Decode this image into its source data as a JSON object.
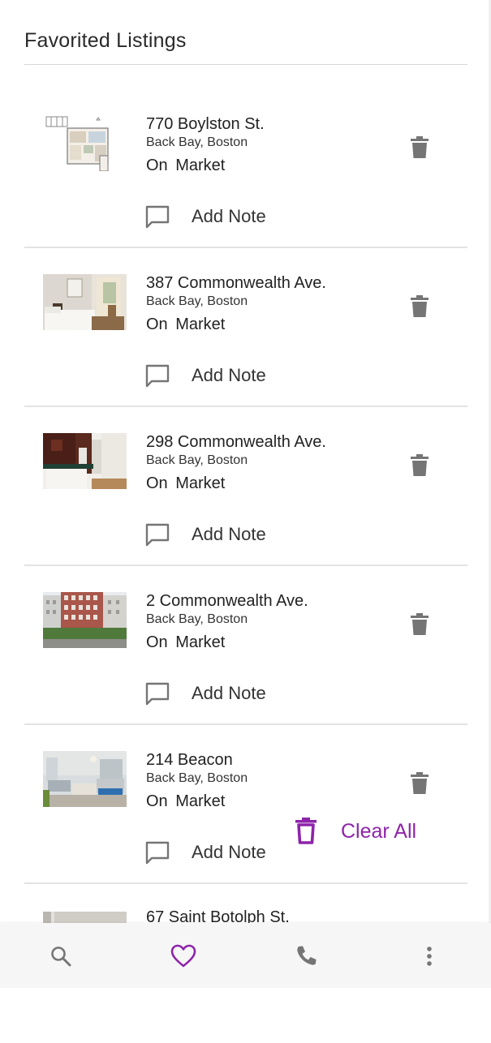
{
  "header": {
    "title": "Favorited Listings"
  },
  "listings": [
    {
      "address": "770 Boylston St.",
      "neighborhood": "Back Bay, Boston",
      "status": "On Market",
      "note_label": "Add Note",
      "photo": "floorplan"
    },
    {
      "address": "387 Commonwealth Ave.",
      "neighborhood": "Back Bay, Boston",
      "status": "On Market",
      "note_label": "Add Note",
      "photo": "bedroom"
    },
    {
      "address": "298 Commonwealth Ave.",
      "neighborhood": "Back Bay, Boston",
      "status": "On Market",
      "note_label": "Add Note",
      "photo": "kitchen"
    },
    {
      "address": "2 Commonwealth Ave.",
      "neighborhood": "Back Bay, Boston",
      "status": "On Market",
      "note_label": "Add Note",
      "photo": "building"
    },
    {
      "address": "214 Beacon",
      "neighborhood": "Back Bay, Boston",
      "status": "On Market",
      "note_label": "Add Note",
      "photo": "living-room"
    },
    {
      "address": "67 Saint Botolph St.",
      "photo": "interior"
    }
  ],
  "clear_all": {
    "label": "Clear All"
  },
  "bottom_nav": {
    "items": [
      {
        "icon": "search-icon",
        "active": false
      },
      {
        "icon": "heart-icon",
        "active": true
      },
      {
        "icon": "phone-icon",
        "active": false
      },
      {
        "icon": "more-vert-icon",
        "active": false
      }
    ]
  },
  "colors": {
    "accent": "#8e24aa",
    "icon_gray": "#757575",
    "divider": "#e3e3e3"
  }
}
